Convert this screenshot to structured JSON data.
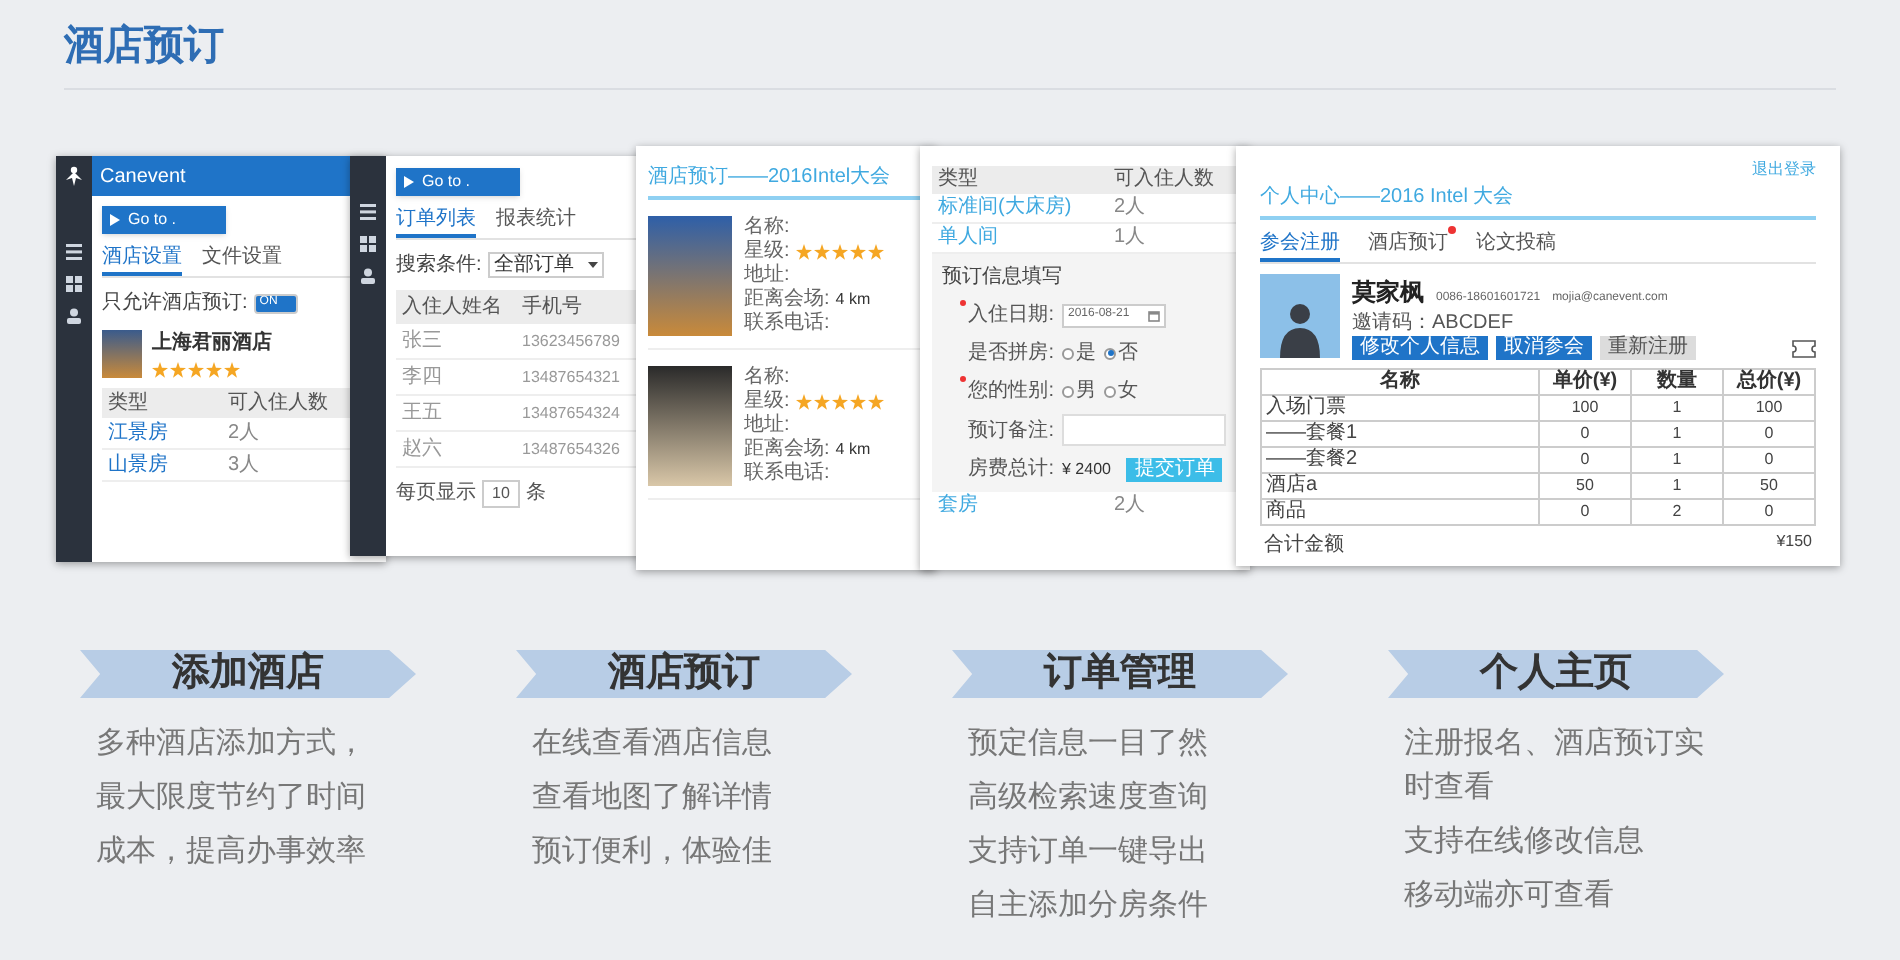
{
  "title": "酒店预订",
  "screenshots": {
    "hotel_settings": {
      "logo": "Canevent",
      "goto": "Go to .",
      "tabs": [
        {
          "label": "酒店设置",
          "selected": true
        },
        {
          "label": "文件设置",
          "selected": false
        }
      ],
      "toggle_label": "只允许酒店预订:",
      "toggle": {
        "text": "ON",
        "on": true
      },
      "hotel": {
        "name": "上海君丽酒店",
        "stars": 5
      },
      "columns": [
        "类型",
        "可入住人数"
      ],
      "rows": [
        [
          "江景房",
          "2人"
        ],
        [
          "山景房",
          "3人"
        ]
      ]
    },
    "order_list": {
      "goto": "Go to .",
      "tabs": [
        {
          "label": "订单列表",
          "selected": true
        },
        {
          "label": "报表统计",
          "selected": false
        }
      ],
      "search_label": "搜索条件:",
      "search_value": "全部订单",
      "columns": [
        "入住人姓名",
        "手机号"
      ],
      "rows": [
        [
          "张三",
          "13623456789"
        ],
        [
          "李四",
          "13487654321"
        ],
        [
          "王五",
          "13487654324"
        ],
        [
          "赵六",
          "13487654326"
        ]
      ],
      "pager_label": "每页显示",
      "pager_value": "10",
      "pager_unit": "条"
    },
    "hotel_list": {
      "title": "酒店预订——2016Intel大会",
      "hotels": [
        {
          "labels": [
            "名称:",
            "星级:",
            "地址:",
            "距离会场:",
            "联系电话:"
          ],
          "stars": 5,
          "distance": "4 km"
        },
        {
          "labels": [
            "名称:",
            "星级:",
            "地址:",
            "距离会场:",
            "联系电话:"
          ],
          "stars": 5,
          "distance": "4 km"
        }
      ]
    },
    "booking_form": {
      "columns": [
        "类型",
        "可入住人数"
      ],
      "rows": [
        [
          "标准间(大床房)",
          "2人"
        ],
        [
          "单人间",
          "1人"
        ]
      ],
      "form_title": "预订信息填写",
      "date_label": "入住日期:",
      "date_value": "2016-08-21",
      "share_label": "是否拼房:",
      "share_options": [
        {
          "label": "是",
          "selected": false
        },
        {
          "label": "否",
          "selected": true
        }
      ],
      "gender_label": "您的性别:",
      "gender_options": [
        {
          "label": "男",
          "selected": false
        },
        {
          "label": "女",
          "selected": false
        }
      ],
      "note_label": "预订备注:",
      "total_label": "房费总计:",
      "total_value": "¥ 2400",
      "submit": "提交订单",
      "last_row": [
        "套房",
        "2人"
      ]
    },
    "personal_center": {
      "logout": "退出登录",
      "title": "个人中心——2016 Intel 大会",
      "tabs": [
        {
          "label": "参会注册",
          "selected": true,
          "badge": false
        },
        {
          "label": "酒店预订",
          "selected": false,
          "badge": true
        },
        {
          "label": "论文投稿",
          "selected": false,
          "badge": false
        }
      ],
      "name": "莫家枫",
      "phone": "0086-18601601721",
      "email": "mojia@canevent.com",
      "code": "邀请码：ABCDEF",
      "buttons": [
        {
          "label": "修改个人信息",
          "disabled": false
        },
        {
          "label": "取消参会",
          "disabled": false
        },
        {
          "label": "重新注册",
          "disabled": true
        }
      ],
      "columns": [
        "名称",
        "单价(¥)",
        "数量",
        "总价(¥)"
      ],
      "rows": [
        [
          "入场门票",
          "100",
          "1",
          "100"
        ],
        [
          "——套餐1",
          "0",
          "1",
          "0"
        ],
        [
          "——套餐2",
          "0",
          "1",
          "0"
        ],
        [
          "酒店a",
          "50",
          "1",
          "50"
        ],
        [
          "商品",
          "0",
          "2",
          "0"
        ]
      ],
      "total_label": "合计金额",
      "total_value": "¥150"
    }
  },
  "features": [
    {
      "title": "添加酒店",
      "items": [
        "多种酒店添加方式，",
        "最大限度节约了时间",
        "成本，提高办事效率"
      ]
    },
    {
      "title": "酒店预订",
      "items": [
        "在线查看酒店信息",
        "查看地图了解详情",
        "预订便利，体验佳"
      ]
    },
    {
      "title": "订单管理",
      "items": [
        "预定信息一目了然",
        "高级检索速度查询",
        "支持订单一键导出",
        "自主添加分房条件"
      ]
    },
    {
      "title": "个人主页",
      "items": [
        "注册报名、酒店预订实时查看",
        "支持在线修改信息",
        "移动端亦可查看"
      ]
    }
  ]
}
